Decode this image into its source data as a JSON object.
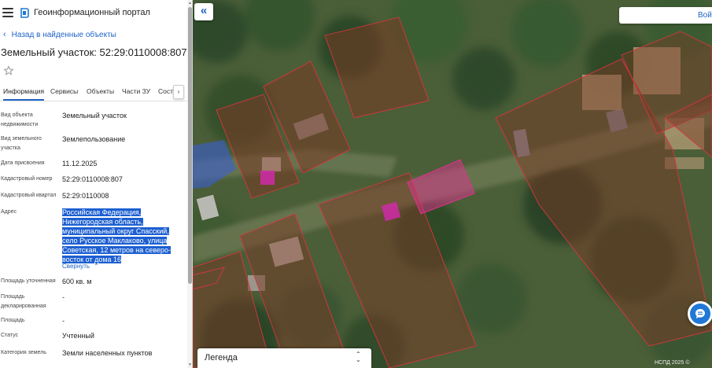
{
  "app": {
    "title": "Геоинформационный портал"
  },
  "back_link": "Назад в найденные объекты",
  "object_title": "Земельный участок: 52:29:0110008:807",
  "tabs": [
    "Информация",
    "Сервисы",
    "Объекты",
    "Части ЗУ",
    "Состав"
  ],
  "active_tab": "Информация",
  "properties": [
    {
      "label": "Вид объекта недвижимости",
      "value": "Земельный участок"
    },
    {
      "label": "Вид земельного участка",
      "value": "Землепользование"
    },
    {
      "label": "Дата присвоения",
      "value": "11.12.2025"
    },
    {
      "label": "Кадастровый номер",
      "value": "52:29:0110008:807"
    },
    {
      "label": "Кадастровый квартал",
      "value": "52:29:0110008"
    },
    {
      "label": "Адрес",
      "value": "Российская Федерация, Нижегородская область, муниципальный округ Спасский, село Русское Маклаково, улица Советская, 12 метров на северо-восток от дома 16"
    },
    {
      "label": "Площадь уточненная",
      "value": "600 кв. м"
    },
    {
      "label": "Площадь декларированная",
      "value": "-"
    },
    {
      "label": "Площадь",
      "value": "-"
    },
    {
      "label": "Статус",
      "value": "Учтенный"
    },
    {
      "label": "Категория земель",
      "value": "Земли населенных пунктов"
    }
  ],
  "address_lines": [
    "Российская Федерация,",
    "Нижегородская область,",
    "муниципальный округ Спасский,",
    "село Русское Маклаково, улица",
    "Советская, 12 метров на северо-",
    "восток от дома 16"
  ],
  "collapse_link": "Свернуть",
  "map": {
    "login_label": "Войти",
    "legend_label": "Легенда",
    "copyright": "НСПД 2025 ©"
  },
  "icons": {
    "menu": "hamburger-menu-icon",
    "logo": "portal-logo-icon",
    "back": "chevron-left-icon",
    "favorite": "star-outline-icon",
    "tab_next": "chevron-right-icon",
    "collapse_panel": "double-chevron-left-icon",
    "chat": "chat-bubble-icon",
    "legend_toggle": "chevron-up-down-icon"
  },
  "colors": {
    "accent": "#1f63c6",
    "selection": "#1c5fd1",
    "parcel_border": "#d9353f",
    "parcel_highlight": "#e0318f"
  }
}
